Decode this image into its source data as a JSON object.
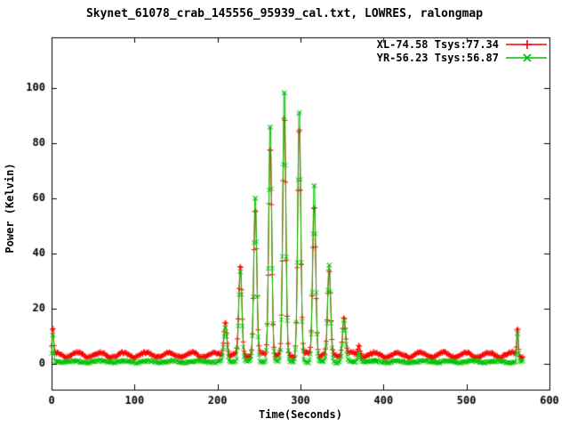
{
  "title": "Skynet_61078_crab_145556_95939_cal.txt, LOWRES, ralongmap",
  "legend": [
    {
      "label": "XL-74.58 Tsys:77.34",
      "color": "#ff0000",
      "marker": "plus"
    },
    {
      "label": "YR-56.23 Tsys:56.87",
      "color": "#00c000",
      "marker": "cross"
    }
  ],
  "colors": {
    "red_series": "#ff0000",
    "green_series": "#00c000",
    "axis": "#000000",
    "background": "#ffffff"
  },
  "chart_data": {
    "type": "line",
    "title": "Skynet_61078_crab_145556_95939_cal.txt, LOWRES, ralongmap",
    "xlabel": "Time(Seconds)",
    "ylabel": "Power (Kelvin)",
    "xlim": [
      0,
      600
    ],
    "ylim": [
      -9.3,
      118.2
    ],
    "xticks": [
      0,
      100,
      200,
      300,
      400,
      500,
      600
    ],
    "yticks": [
      0,
      20,
      40,
      60,
      80,
      100
    ],
    "grid": false,
    "legend_position": "top-right-inside",
    "marker_style": "linespoints",
    "t_start": 0,
    "t_end": 568,
    "dt": 1,
    "series": [
      {
        "name": "XL-74.58 Tsys:77.34",
        "color": "#ff0000",
        "marker": "plus",
        "baseline": {
          "mean": 3.3,
          "wave_amp": 0.85,
          "wave_period": 27.5,
          "wave_phase": 0.6,
          "noise": 0.4
        },
        "peaks": [
          {
            "t": 1.5,
            "v": 13.5,
            "w": 0.9
          },
          {
            "t": 209.5,
            "v": 16.0,
            "w": 1.8
          },
          {
            "t": 227.5,
            "v": 36.0,
            "w": 1.8
          },
          {
            "t": 245.5,
            "v": 57.0,
            "w": 1.8
          },
          {
            "t": 263.5,
            "v": 81.0,
            "w": 1.8
          },
          {
            "t": 280.5,
            "v": 91.0,
            "w": 1.8
          },
          {
            "t": 298.5,
            "v": 88.0,
            "w": 1.8
          },
          {
            "t": 316.5,
            "v": 59.0,
            "w": 1.8
          },
          {
            "t": 334.5,
            "v": 34.0,
            "w": 1.8
          },
          {
            "t": 352.5,
            "v": 17.5,
            "w": 1.8
          },
          {
            "t": 370.5,
            "v": 7.0,
            "w": 1.5
          },
          {
            "t": 561.5,
            "v": 14.0,
            "w": 0.9
          }
        ]
      },
      {
        "name": "YR-56.23 Tsys:56.87",
        "color": "#00c000",
        "marker": "cross",
        "baseline": {
          "mean": 0.8,
          "wave_amp": 0.3,
          "wave_period": 30,
          "wave_phase": 2.1,
          "noise": 0.35
        },
        "peaks": [
          {
            "t": 1.5,
            "v": 12.0,
            "w": 0.9
          },
          {
            "t": 209.5,
            "v": 13.5,
            "w": 1.8
          },
          {
            "t": 227.5,
            "v": 35.0,
            "w": 1.8
          },
          {
            "t": 245.5,
            "v": 62.0,
            "w": 1.8
          },
          {
            "t": 263.5,
            "v": 89.0,
            "w": 1.8
          },
          {
            "t": 280.5,
            "v": 102.0,
            "w": 1.8
          },
          {
            "t": 298.5,
            "v": 94.0,
            "w": 1.8
          },
          {
            "t": 316.5,
            "v": 67.0,
            "w": 1.8
          },
          {
            "t": 334.5,
            "v": 37.0,
            "w": 1.8
          },
          {
            "t": 352.5,
            "v": 16.5,
            "w": 1.8
          },
          {
            "t": 370.5,
            "v": 4.0,
            "w": 1.5
          },
          {
            "t": 561.5,
            "v": 12.5,
            "w": 0.9
          }
        ]
      }
    ]
  }
}
